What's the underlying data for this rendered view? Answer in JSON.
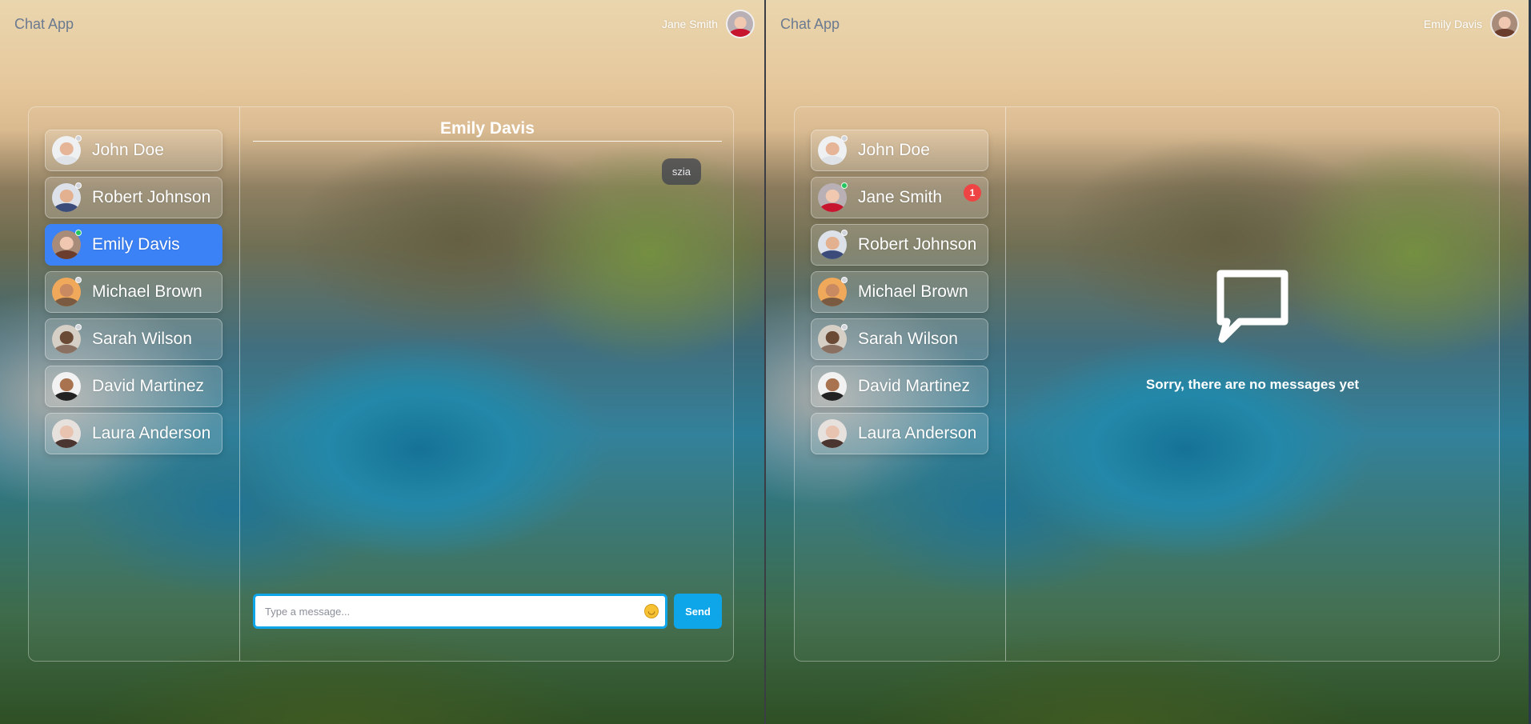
{
  "colors": {
    "accent": "#3b82f6",
    "send": "#0ea5e9",
    "online": "#22c55e",
    "offline": "#d1d5db",
    "badge": "#ef4444"
  },
  "left": {
    "app_title": "Chat App",
    "current_user": "Jane Smith",
    "contacts": [
      {
        "name": "John Doe",
        "online": false
      },
      {
        "name": "Robert Johnson",
        "online": false
      },
      {
        "name": "Emily Davis",
        "online": true,
        "active": true
      },
      {
        "name": "Michael Brown",
        "online": false
      },
      {
        "name": "Sarah Wilson",
        "online": false
      },
      {
        "name": "David Martinez",
        "online": false
      },
      {
        "name": "Laura Anderson",
        "online": false
      }
    ],
    "chat": {
      "title": "Emily Davis",
      "messages": [
        {
          "text": "szia",
          "from": "self"
        }
      ],
      "input_placeholder": "Type a message...",
      "emoji_icon": "smiley-icon",
      "send_label": "Send"
    }
  },
  "right": {
    "app_title": "Chat App",
    "current_user": "Emily Davis",
    "contacts": [
      {
        "name": "John Doe",
        "online": false
      },
      {
        "name": "Jane Smith",
        "online": true,
        "unread": "1"
      },
      {
        "name": "Robert Johnson",
        "online": false
      },
      {
        "name": "Michael Brown",
        "online": false
      },
      {
        "name": "Sarah Wilson",
        "online": false
      },
      {
        "name": "David Martinez",
        "online": false
      },
      {
        "name": "Laura Anderson",
        "online": false
      }
    ],
    "empty_state": {
      "icon": "chat-bubble-icon",
      "text": "Sorry, there are no messages yet"
    }
  }
}
